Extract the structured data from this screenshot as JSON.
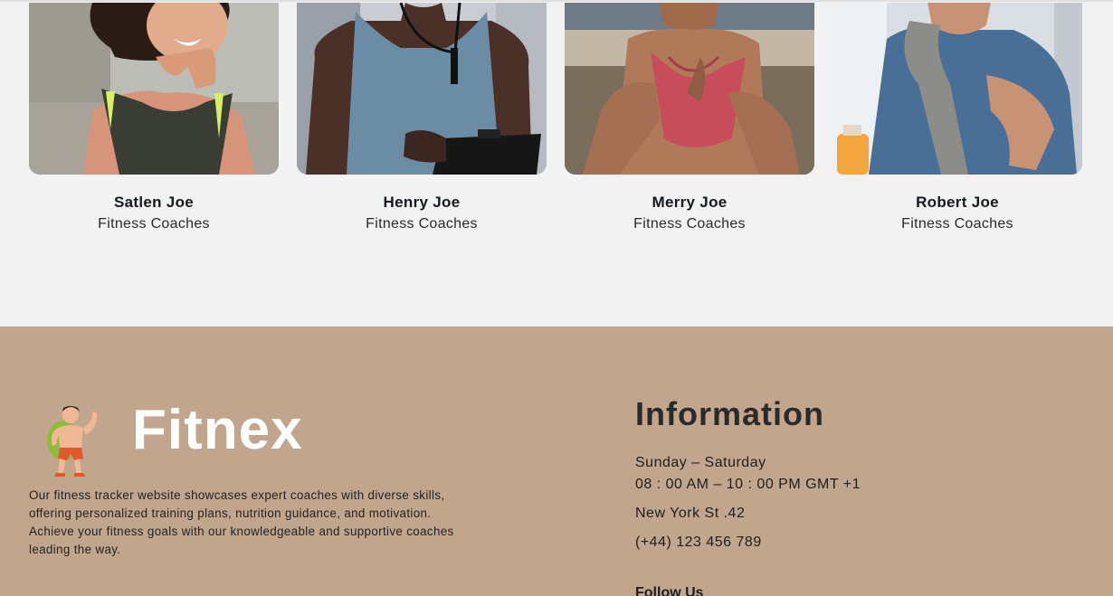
{
  "coaches": [
    {
      "name": "Satlen Joe",
      "role": "Fitness Coaches",
      "photo_alt": "coach-photo-satlen"
    },
    {
      "name": "Henry Joe",
      "role": "Fitness Coaches",
      "photo_alt": "coach-photo-henry"
    },
    {
      "name": "Merry Joe",
      "role": "Fitness Coaches",
      "photo_alt": "coach-photo-merry"
    },
    {
      "name": "Robert Joe",
      "role": "Fitness Coaches",
      "photo_alt": "coach-photo-robert"
    }
  ],
  "footer": {
    "brand": "Fitnex",
    "about": "Our fitness tracker website showcases expert coaches with diverse skills, offering personalized training plans, nutrition guidance, and motivation. Achieve your fitness goals with our knowledgeable and supportive coaches leading the way.",
    "info_title": "Information",
    "days": "Sunday – Saturday",
    "hours": "08 : 00 AM – 10 : 00 PM GMT +1",
    "address": "New York St .42",
    "phone": "(+44) 123 456 789",
    "follow_title": "Follow Us"
  },
  "colors": {
    "footer_bg": "#c1a68d",
    "section_bg": "#f2f2f3",
    "brand_text": "#ffffff"
  }
}
